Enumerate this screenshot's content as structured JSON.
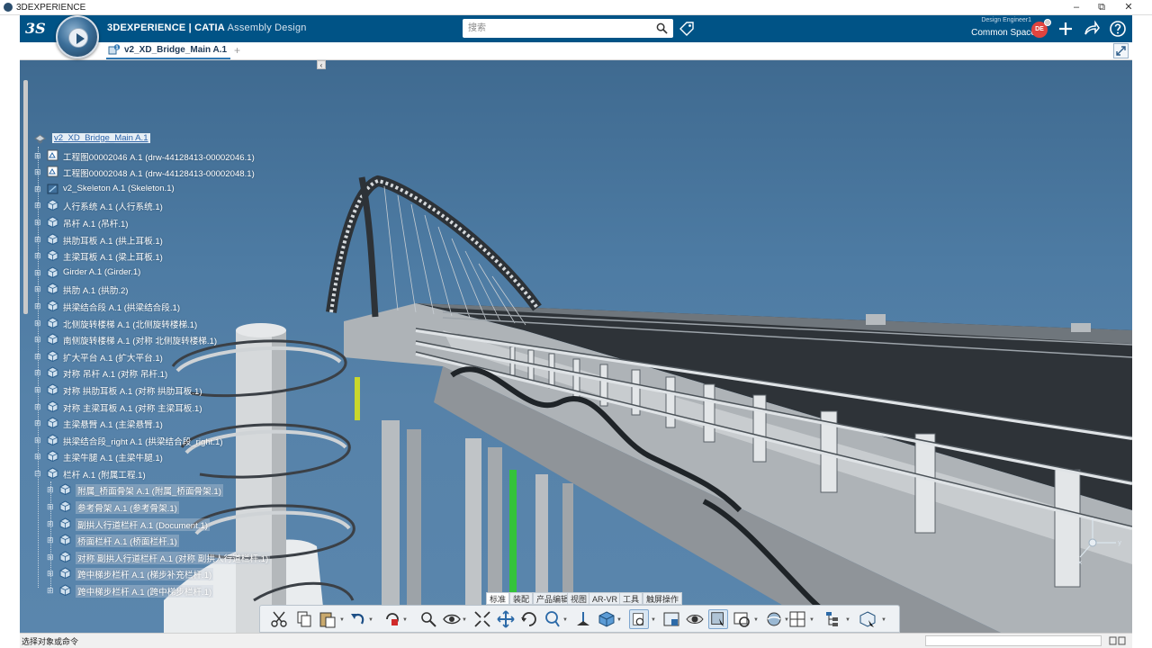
{
  "os_window": {
    "title": "3DEXPERIENCE",
    "minimize": "–",
    "restore": "⧉",
    "close": "✕"
  },
  "header": {
    "brand_bold": "3DEXPERIENCE | CATIA",
    "app_name": "Assembly Design",
    "search_placeholder": "搜索",
    "user_role": "Design Engineer1",
    "space": "Common Space",
    "space_chevron": "⌄",
    "avatar_initials": "DE",
    "icons": [
      "tag-icon",
      "plus-icon",
      "share-icon",
      "help-icon"
    ]
  },
  "tabs": {
    "active_tab": "v2_XD_Bridge_Main A.1",
    "add_tab": "+",
    "collapse_arrow": "‹"
  },
  "tree": {
    "root": "v2_XD_Bridge_Main A.1",
    "items": [
      {
        "label": "工程图00002046 A.1 (drw-44128413-00002046.1)",
        "icon": "drawing-icon",
        "level": 0
      },
      {
        "label": "工程图00002048 A.1 (drw-44128413-00002048.1)",
        "icon": "drawing-icon",
        "level": 0
      },
      {
        "label": "v2_Skeleton A.1 (Skeleton.1)",
        "icon": "skeleton-icon",
        "level": 0
      },
      {
        "label": "人行系统 A.1 (人行系统.1)",
        "icon": "product-icon",
        "level": 0
      },
      {
        "label": "吊杆 A.1 (吊杆.1)",
        "icon": "product-icon",
        "level": 0
      },
      {
        "label": "拱肋耳板 A.1 (拱上耳板.1)",
        "icon": "product-icon",
        "level": 0
      },
      {
        "label": "主梁耳板 A.1 (梁上耳板.1)",
        "icon": "product-icon",
        "level": 0
      },
      {
        "label": "Girder A.1 (Girder.1)",
        "icon": "product-icon",
        "level": 0
      },
      {
        "label": "拱肋 A.1 (拱肋.2)",
        "icon": "product-icon",
        "level": 0
      },
      {
        "label": "拱梁结合段 A.1 (拱梁结合段.1)",
        "icon": "product-icon",
        "level": 0
      },
      {
        "label": "北侧旋转楼梯 A.1 (北侧旋转楼梯.1)",
        "icon": "product-icon",
        "level": 0
      },
      {
        "label": "南侧旋转楼梯 A.1 (对称 北侧旋转楼梯.1)",
        "icon": "product-icon",
        "level": 0
      },
      {
        "label": "扩大平台 A.1 (扩大平台.1)",
        "icon": "product-icon",
        "level": 0
      },
      {
        "label": "对称 吊杆 A.1 (对称 吊杆.1)",
        "icon": "product-icon",
        "level": 0
      },
      {
        "label": "对称 拱肋耳板 A.1 (对称 拱肋耳板.1)",
        "icon": "product-icon",
        "level": 0
      },
      {
        "label": "对称 主梁耳板 A.1 (对称 主梁耳板.1)",
        "icon": "product-icon",
        "level": 0
      },
      {
        "label": "主梁悬臂 A.1 (主梁悬臂.1)",
        "icon": "product-icon",
        "level": 0
      },
      {
        "label": "拱梁结合段_right A.1 (拱梁结合段_right.1)",
        "icon": "product-icon",
        "level": 0
      },
      {
        "label": "主梁牛腿 A.1 (主梁牛腿.1)",
        "icon": "product-icon",
        "level": 0
      },
      {
        "label": "栏杆 A.1 (附属工程.1)",
        "icon": "product-icon",
        "level": 0,
        "expanded": true
      },
      {
        "label": "附属_桥面骨架 A.1 (附属_桥面骨架.1)",
        "icon": "product-icon",
        "level": 1
      },
      {
        "label": "参考骨架 A.1 (参考骨架.1)",
        "icon": "product-icon",
        "level": 1
      },
      {
        "label": "副拱人行道栏杆 A.1 (Document.1)",
        "icon": "product-icon",
        "level": 1
      },
      {
        "label": "桥面栏杆 A.1 (桥面栏杆.1)",
        "icon": "product-icon",
        "level": 1
      },
      {
        "label": "对称 副拱人行道栏杆 A.1 (对称 副拱人行道栏杆.1)",
        "icon": "product-icon",
        "level": 1
      },
      {
        "label": "跨中梯步栏杆 A.1 (梯步补充栏杆.1)",
        "icon": "product-icon",
        "level": 1
      },
      {
        "label": "跨中梯步栏杆 A.1 (跨中梯步栏杆.1)",
        "icon": "product-icon",
        "level": 1
      }
    ]
  },
  "section_tabs": [
    "标准",
    "装配",
    "产品编辑",
    "视图",
    "AR-VR",
    "工具",
    "触屏操作"
  ],
  "section_active": "标准",
  "action_bar": [
    "cut-icon",
    "copy-icon",
    "paste-icon",
    "undo-icon",
    "update-icon",
    "zoom-icon",
    "fly-icon",
    "fit-all-icon",
    "pan-icon",
    "rotate-icon",
    "zoom-in-icon",
    "normal-view-icon",
    "view-mode-icon",
    "hide-show-icon",
    "capture-icon",
    "visualize-icon",
    "selection-icon",
    "render-icon",
    "explode-icon",
    "compass-icon",
    "layout-icon",
    "tree-icon",
    "publish-icon"
  ],
  "status": {
    "message": "选择对象或命令"
  },
  "colors": {
    "topbar": "#005386",
    "viewport_top": "#3f6a90",
    "viewport_bottom": "#5a86ad",
    "highlight_text": "#2a62a8"
  }
}
